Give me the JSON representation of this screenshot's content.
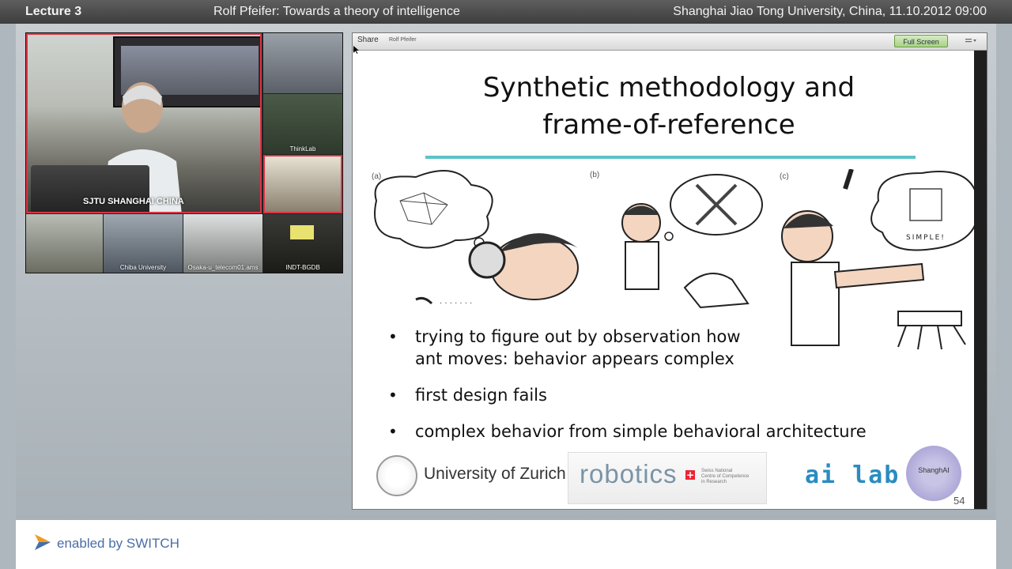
{
  "topbar": {
    "left": "Lecture 3",
    "center": "Rolf Pfeifer: Towards a theory of intelligence",
    "right": "Shanghai Jiao Tong University, China, 11.10.2012 09:00"
  },
  "video": {
    "main_label": "SJTU SHANGHAI CHINA",
    "tiles": [
      "",
      "ThinkLab",
      "",
      "",
      "Chiba University",
      "Osaka-u_telecom01.ams",
      "INDT-BGDB"
    ]
  },
  "share": {
    "title": "Share",
    "presenter": "Rolf Pfeifer",
    "fullscreen_label": "Full Screen",
    "menu_icon": "menu-icon"
  },
  "slide": {
    "title_line1": "Synthetic methodology and",
    "title_line2": "frame-of-reference",
    "panel_labels": [
      "(a)",
      "(b)",
      "(c)"
    ],
    "bubble_text": "SIMPLE!",
    "bullets": [
      "trying to figure out by observation how\nant moves: behavior appears complex",
      "first design fails",
      "complex behavior from simple behavioral architecture"
    ],
    "logos": {
      "uzh": "University of Zurich",
      "robotics": "robotics",
      "robotics_sub": "Swiss National\nCentre of Competence\nin Research",
      "ailab": "ai lab",
      "shanghai": "ShanghAI"
    },
    "page_number": "54"
  },
  "bottombar": {
    "brand": "enabled by SWITCH",
    "accent": "#f29a1e"
  }
}
